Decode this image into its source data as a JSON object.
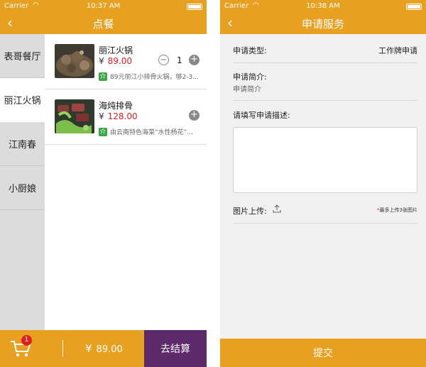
{
  "left": {
    "status": {
      "carrier": "Carrier",
      "time": "10:37 AM"
    },
    "nav": {
      "back": "‹",
      "title": "点餐"
    },
    "sidebar": [
      {
        "label": "表哥餐厅",
        "active": false
      },
      {
        "label": "丽江火锅",
        "active": true
      },
      {
        "label": "江南春",
        "active": false
      },
      {
        "label": "小厨娘",
        "active": false
      }
    ],
    "foods": [
      {
        "name": "丽江火锅",
        "currency": "¥",
        "price": "89.00",
        "tag": "介",
        "desc": "89元丽江小排骨火锅，够2-3...",
        "qty": "1",
        "minus": "−",
        "plus": "+"
      },
      {
        "name": "海炖排骨",
        "currency": "¥",
        "price": "128.00",
        "tag": "介",
        "desc": "由云南特色海菜“水性杨花”...",
        "plus": "+"
      }
    ],
    "cart": {
      "badge": "1",
      "currency": "¥",
      "total": "89.00",
      "checkout": "去结算"
    }
  },
  "right": {
    "status": {
      "carrier": "Carrier",
      "time": "10:38 AM"
    },
    "nav": {
      "back": "‹",
      "title": "申请服务"
    },
    "form": {
      "type_label": "申请类型:",
      "type_value": "工作牌申请",
      "intro_label": "申请简介:",
      "intro_value": "申请简介",
      "desc_label": "请填写申请描述:",
      "desc_value": "",
      "upload_label": "图片上传:",
      "upload_hint_star": "*",
      "upload_hint": "最多上传3张图片"
    },
    "submit": "提交"
  },
  "colors": {
    "accent": "#e8a020",
    "checkout": "#5c2a6a",
    "price": "#e02020",
    "tag": "#3aa844"
  }
}
